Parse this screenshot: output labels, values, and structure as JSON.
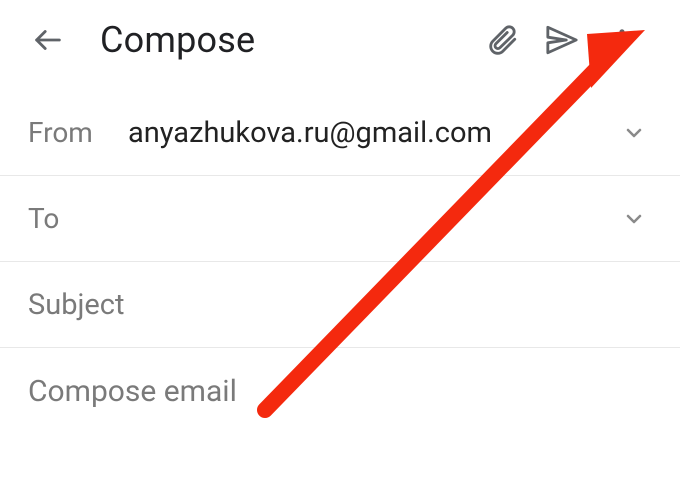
{
  "topbar": {
    "title": "Compose"
  },
  "from": {
    "label": "From",
    "value": "anyazhukova.ru@gmail.com"
  },
  "to": {
    "label": "To",
    "value": ""
  },
  "subject": {
    "placeholder": "Subject",
    "value": ""
  },
  "body": {
    "placeholder": "Compose email",
    "value": ""
  },
  "annotation": {
    "color": "#f4290e"
  }
}
